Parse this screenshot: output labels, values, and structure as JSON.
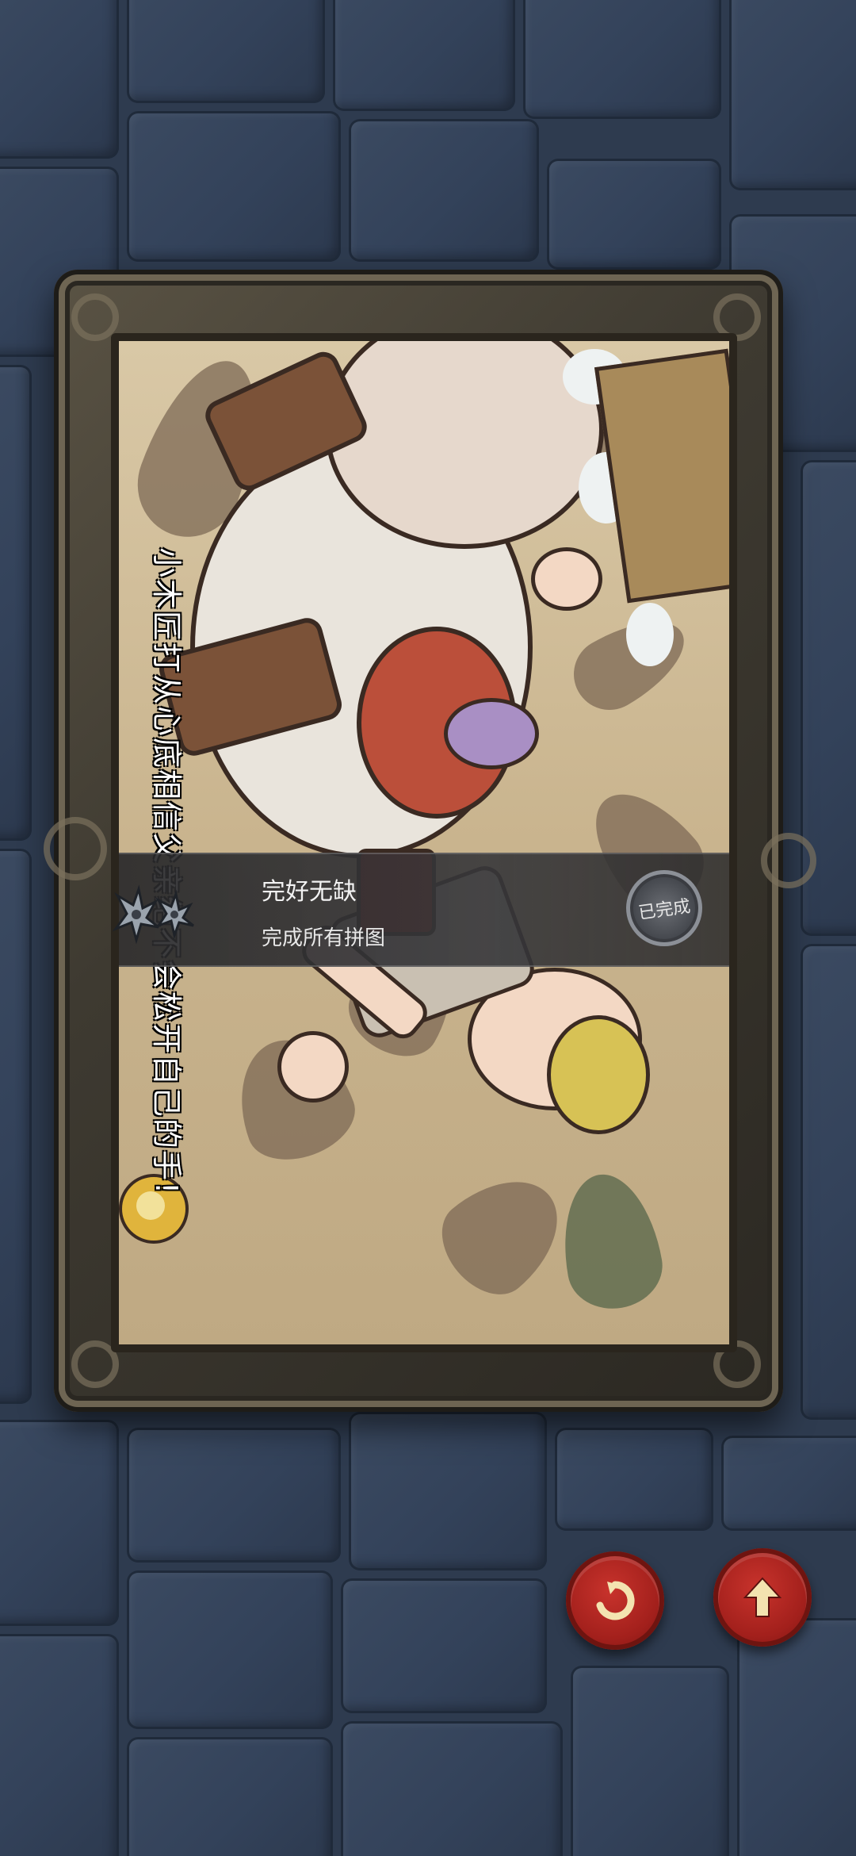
{
  "caption": "小木匠打从心底相信父亲绝不会松开自己的手!",
  "achievement": {
    "title": "完好无缺",
    "description": "完成所有拼图",
    "status": "已完成"
  },
  "buttons": {
    "rotate_icon": "rotate-icon",
    "up_icon": "arrow-up-icon"
  },
  "colors": {
    "button_red": "#b0241f",
    "wall_blue": "#2e3b4f",
    "frame_bronze": "#5a5344"
  }
}
